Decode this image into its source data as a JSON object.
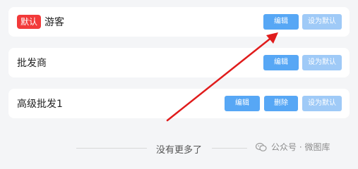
{
  "addresses": [
    {
      "badge": "默认",
      "name": "游客",
      "edit_label": "编辑",
      "set_default_label": "设为默认"
    },
    {
      "name": "批发商",
      "edit_label": "编辑",
      "set_default_label": "设为默认"
    },
    {
      "name": "高级批发1",
      "edit_label": "编辑",
      "delete_label": "删除",
      "set_default_label": "设为默认"
    }
  ],
  "footer": {
    "no_more_text": "没有更多了"
  },
  "watermark": {
    "text": "公众号 · 微图库"
  },
  "colors": {
    "accent": "#57a7f5",
    "badge": "#f23a3a",
    "arrow": "#e01c1c"
  }
}
